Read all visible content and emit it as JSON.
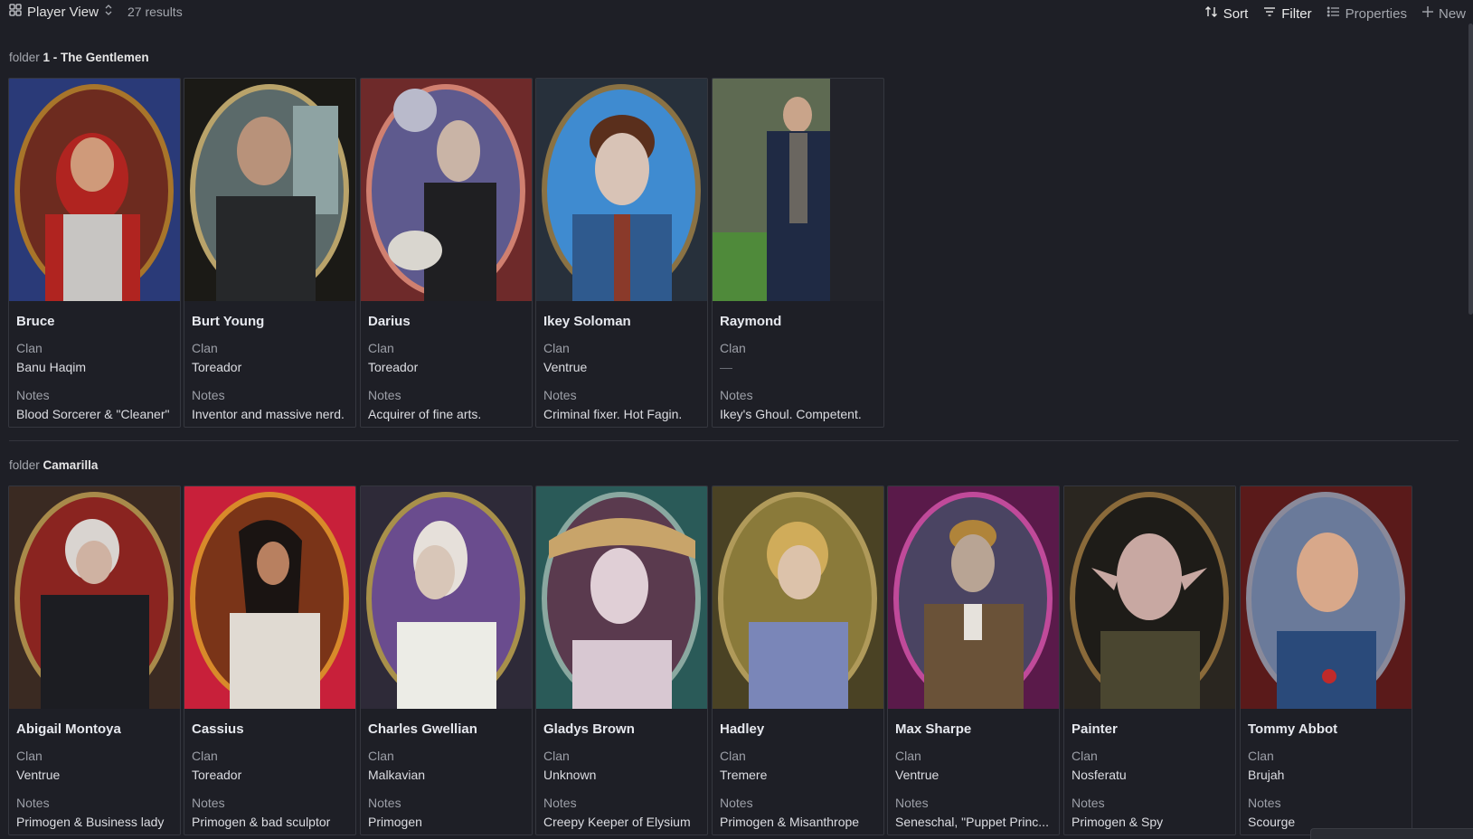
{
  "toolbar": {
    "view_label": "Player View",
    "results": "27 results",
    "sort_label": "Sort",
    "filter_label": "Filter",
    "properties_label": "Properties",
    "new_label": "New"
  },
  "groups": [
    {
      "prefix": "folder",
      "title": "1 - The Gentlemen",
      "cards": [
        {
          "name": "Bruce",
          "clan_label": "Clan",
          "clan": "Banu Haqim",
          "notes_label": "Notes",
          "notes": "Blood Sorcerer & \"Cleaner\""
        },
        {
          "name": "Burt Young",
          "clan_label": "Clan",
          "clan": "Toreador",
          "notes_label": "Notes",
          "notes": "Inventor and massive nerd."
        },
        {
          "name": "Darius",
          "clan_label": "Clan",
          "clan": "Toreador",
          "notes_label": "Notes",
          "notes": "Acquirer of fine arts."
        },
        {
          "name": "Ikey Soloman",
          "clan_label": "Clan",
          "clan": "Ventrue",
          "notes_label": "Notes",
          "notes": "Criminal fixer. Hot Fagin."
        },
        {
          "name": "Raymond",
          "clan_label": "Clan",
          "clan": "—",
          "notes_label": "Notes",
          "notes": "Ikey's Ghoul. Competent."
        }
      ]
    },
    {
      "prefix": "folder",
      "title": "Camarilla",
      "cards": [
        {
          "name": "Abigail Montoya",
          "clan_label": "Clan",
          "clan": "Ventrue",
          "notes_label": "Notes",
          "notes": "Primogen & Business lady"
        },
        {
          "name": "Cassius",
          "clan_label": "Clan",
          "clan": "Toreador",
          "notes_label": "Notes",
          "notes": "Primogen & bad sculptor"
        },
        {
          "name": "Charles Gwellian",
          "clan_label": "Clan",
          "clan": "Malkavian",
          "notes_label": "Notes",
          "notes": "Primogen"
        },
        {
          "name": "Gladys Brown",
          "clan_label": "Clan",
          "clan": "Unknown",
          "notes_label": "Notes",
          "notes": "Creepy Keeper of Elysium"
        },
        {
          "name": "Hadley",
          "clan_label": "Clan",
          "clan": "Tremere",
          "notes_label": "Notes",
          "notes": "Primogen & Misanthrope"
        },
        {
          "name": "Max Sharpe",
          "clan_label": "Clan",
          "clan": "Ventrue",
          "notes_label": "Notes",
          "notes": "Seneschal, \"Puppet Princ..."
        },
        {
          "name": "Painter",
          "clan_label": "Clan",
          "clan": "Nosferatu",
          "notes_label": "Notes",
          "notes": "Primogen & Spy"
        },
        {
          "name": "Tommy Abbot",
          "clan_label": "Clan",
          "clan": "Brujah",
          "notes_label": "Notes",
          "notes": "Scourge"
        }
      ]
    }
  ],
  "colors": {
    "background": "#1e1f26",
    "card_border": "#35373f",
    "muted_text": "#a4a7ae"
  },
  "icons": [
    "grid-icon",
    "chevron-updown-icon",
    "sort-icon",
    "filter-icon",
    "list-icon",
    "plus-icon"
  ]
}
